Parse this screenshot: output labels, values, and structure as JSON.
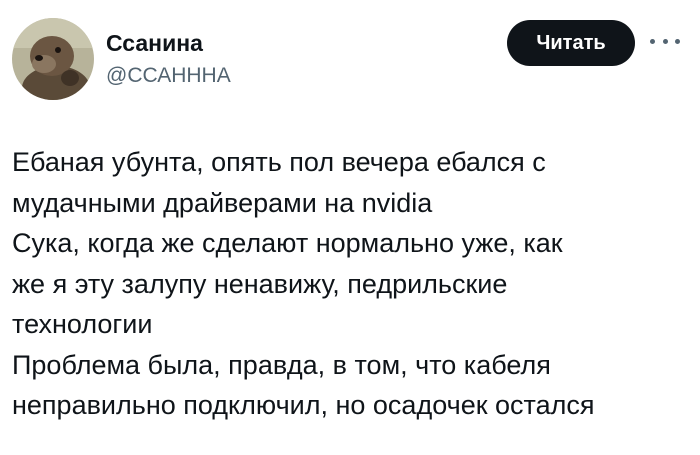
{
  "author": {
    "display_name": "Ссанина",
    "handle": "@ССАНННА",
    "avatar_icon": "otter-avatar"
  },
  "actions": {
    "follow_label": "Читать",
    "more_icon": "more-horizontal-icon"
  },
  "tweet": {
    "lines": [
      "Ебаная убунта, опять пол вечера ебался с",
      "мудачными драйверами на nvidia",
      "Сука, когда же сделают нормально уже, как",
      "же я эту залупу ненавижу, педрильские",
      "технологии",
      "Проблема была, правда, в том, что кабеля",
      "неправильно подключил, но осадочек остался"
    ]
  },
  "colors": {
    "text_primary": "#0f1419",
    "text_secondary": "#536471",
    "button_bg": "#0f1419",
    "button_text": "#ffffff"
  }
}
